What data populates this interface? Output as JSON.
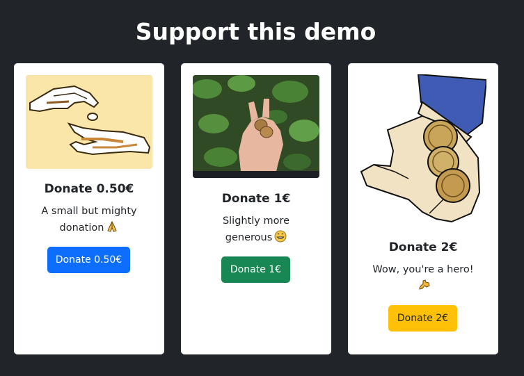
{
  "page": {
    "title": "Support this demo"
  },
  "cards": [
    {
      "image_alt": "hand dropping coin into another hand",
      "title": "Donate 0.50€",
      "text": "A small but mighty donation",
      "emoji_icon": "folded-hands-icon",
      "button_label": "Donate 0.50€",
      "button_color": "#0d6efd"
    },
    {
      "image_alt": "coins in palm over green plants",
      "title": "Donate 1€",
      "text": "Slightly more generous",
      "emoji_icon": "grinning-face-icon",
      "button_label": "Donate 1€",
      "button_color": "#198754"
    },
    {
      "image_alt": "hand holding pile of gold coins",
      "title": "Donate 2€",
      "text": "Wow, you're a hero!",
      "emoji_icon": "flexed-biceps-icon",
      "button_label": "Donate 2€",
      "button_color": "#ffc107"
    }
  ],
  "colors": {
    "background": "#212529",
    "card": "#ffffff",
    "text": "#212529"
  }
}
